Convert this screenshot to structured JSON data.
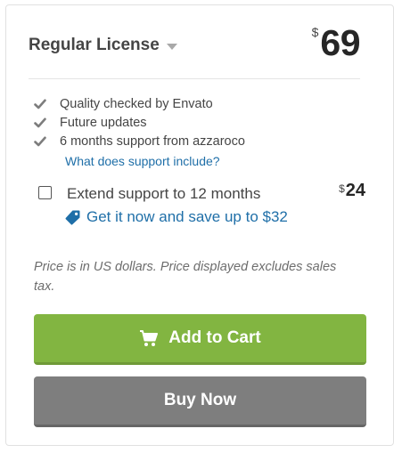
{
  "license": {
    "title": "Regular License",
    "currency_symbol": "$",
    "price": "69"
  },
  "features": [
    {
      "icon": "check-icon",
      "text": "Quality checked by Envato"
    },
    {
      "icon": "check-icon",
      "text": "Future updates"
    },
    {
      "icon": "check-icon",
      "text": "6 months support from azzaroco"
    }
  ],
  "support_link": "What does support include?",
  "extend": {
    "label": "Extend support to 12 months",
    "currency_symbol": "$",
    "price": "24",
    "checked": false,
    "save_text": "Get it now and save up to $32",
    "save_icon": "tag-icon"
  },
  "price_note": "Price is in US dollars. Price displayed excludes sales tax.",
  "buttons": {
    "add_to_cart": "Add to Cart",
    "add_to_cart_icon": "cart-icon",
    "buy_now": "Buy Now"
  },
  "colors": {
    "primary_green": "#82b541",
    "secondary_gray": "#7e7e7e",
    "link_blue": "#1f6fa8"
  }
}
